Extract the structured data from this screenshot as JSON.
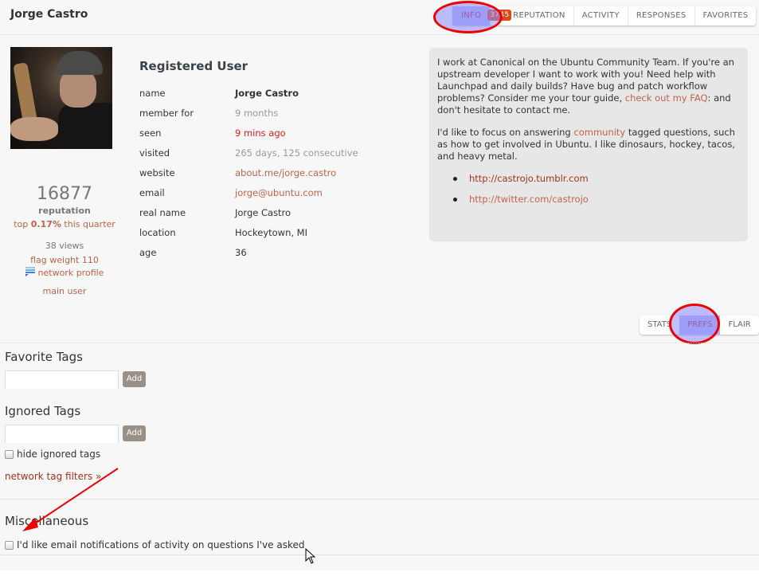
{
  "header": {
    "user_name": "Jorge Castro",
    "tabs": [
      {
        "label": "INFO",
        "active": true
      },
      {
        "label": "REPUTATION",
        "badge": "3745"
      },
      {
        "label": "ACTIVITY"
      },
      {
        "label": "RESPONSES"
      },
      {
        "label": "FAVORITES"
      }
    ]
  },
  "profile": {
    "avatar_alt": "Jorge Castro avatar",
    "reputation": "16877",
    "reputation_label": "reputation",
    "rank_prefix": "top ",
    "rank_value": "0.17%",
    "rank_suffix": " this quarter",
    "views": "38 views",
    "flag_weight": "flag weight 110",
    "network_profile": "network profile",
    "main_user": "main user"
  },
  "details": {
    "title": "Registered User",
    "rows": [
      {
        "key": "name",
        "value": "Jorge Castro"
      },
      {
        "key": "member for",
        "value": "9 months"
      },
      {
        "key": "seen",
        "value": "9 mins ago"
      },
      {
        "key": "visited",
        "value": "265 days, 125 consecutive"
      },
      {
        "key": "website",
        "value": "about.me/jorge.castro"
      },
      {
        "key": "email",
        "value": "jorge@ubuntu.com"
      },
      {
        "key": "real name",
        "value": "Jorge Castro"
      },
      {
        "key": "location",
        "value": "Hockeytown, MI"
      },
      {
        "key": "age",
        "value": "36"
      }
    ]
  },
  "bio": {
    "p1_a": "I work at Canonical on the Ubuntu Community Team. If you're an upstream developer I want to work with you! Need help with Launchpad and daily builds? Have bug and patch workflow problems? Consider me your tour guide, ",
    "p1_link": "check out my FAQ",
    "p1_b": ": and don't hesitate to contact me.",
    "p2_a": "I'd like to focus on answering ",
    "p2_link": "community",
    "p2_b": " tagged questions, such as how to get involved in Ubuntu. I like dinosaurs, hockey, tacos, and heavy metal.",
    "links": [
      "http://castrojo.tumblr.com",
      "http://twitter.com/castrojo"
    ]
  },
  "subtabs": [
    {
      "label": "STATS"
    },
    {
      "label": "PREFS",
      "active": true
    },
    {
      "label": "FLAIR"
    }
  ],
  "prefs": {
    "favorite_tags": {
      "heading": "Favorite Tags",
      "input_value": "",
      "add_label": "Add"
    },
    "ignored_tags": {
      "heading": "Ignored Tags",
      "input_value": "",
      "add_label": "Add"
    },
    "hide_ignored_label": "hide ignored tags",
    "hide_ignored_checked": false,
    "network_tag_filters": "network tag filters »",
    "misc_heading": "Miscellaneous",
    "email_notify_label": "I'd like email notifications of activity on questions I've asked",
    "email_notify_checked": false
  },
  "annotations": {
    "highlight_color": "#b4b4f4",
    "circle_color": "#ee0000",
    "arrow_color": "#ee0000"
  }
}
